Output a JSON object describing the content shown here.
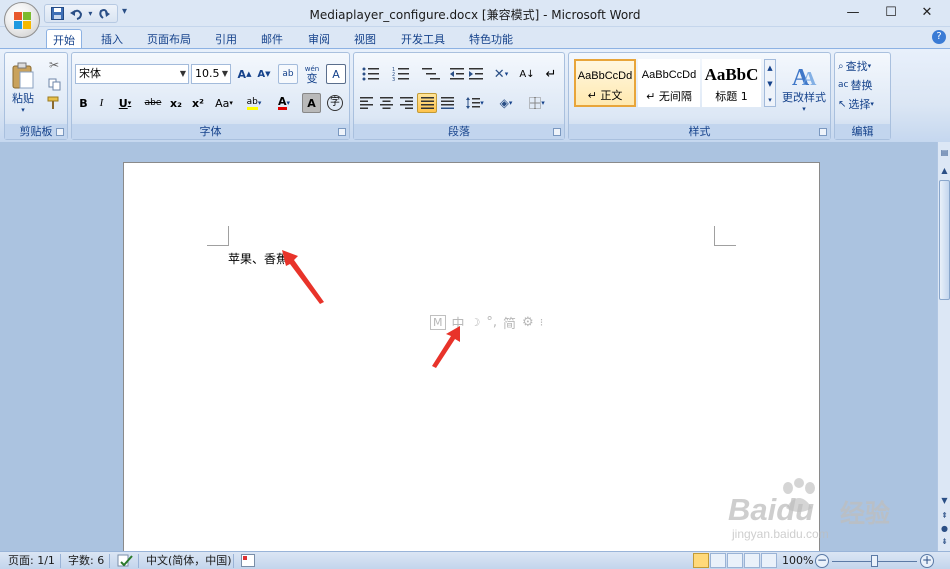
{
  "window": {
    "title": "Mediaplayer_configure.docx [兼容模式] - Microsoft Word",
    "minimize": "—",
    "maximize": "☐",
    "close": "✕"
  },
  "qat": {
    "save_icon": "save-icon",
    "undo_icon": "undo-icon",
    "redo_icon": "redo-icon",
    "more": "▾"
  },
  "tabs": [
    {
      "label": "开始",
      "active": true
    },
    {
      "label": "插入"
    },
    {
      "label": "页面布局"
    },
    {
      "label": "引用"
    },
    {
      "label": "邮件"
    },
    {
      "label": "审阅"
    },
    {
      "label": "视图"
    },
    {
      "label": "开发工具"
    },
    {
      "label": "特色功能"
    }
  ],
  "help": "?",
  "ribbon": {
    "clipboard": {
      "label": "剪贴板",
      "paste": "粘贴"
    },
    "font": {
      "label": "字体",
      "font_name": "宋体",
      "font_size": "10.5",
      "grow": "A",
      "shrink": "A",
      "clear": "ab",
      "phonetic": "wén",
      "border_char": "A",
      "bold": "B",
      "italic": "I",
      "underline": "U",
      "strike": "abe",
      "subscript": "x₂",
      "superscript": "x²",
      "case": "Aa",
      "highlight": "ab",
      "font_color": "A",
      "shade": "A",
      "enclose": "字"
    },
    "paragraph": {
      "label": "段落"
    },
    "styles": {
      "label": "样式",
      "items": [
        {
          "sample": "AaBbCcDd",
          "name": "↵ 正文",
          "selected": true
        },
        {
          "sample": "AaBbCcDd",
          "name": "↵ 无间隔"
        },
        {
          "sample": "AaBbC",
          "name": "标题 1"
        }
      ],
      "change": "更改样式"
    },
    "editing": {
      "label": "编辑",
      "find": "查找",
      "replace": "替换",
      "select": "选择"
    }
  },
  "document": {
    "text": "苹果、香蕉、",
    "ime": {
      "mode": "M",
      "lang": "中",
      "moon": "☽",
      "punct": "°,",
      "simp": "简",
      "gear": "⚙",
      "more": "⁝"
    }
  },
  "status": {
    "page": "页面: 1/1",
    "words": "字数: 6",
    "language": "中文(简体，中国)",
    "zoom": "100%",
    "zoom_level": 1.0
  },
  "watermark": {
    "brand": "Baidu",
    "jingyan": "经验",
    "url": "jingyan.baidu.com"
  },
  "colors": {
    "highlight": "#ffff00",
    "font_red": "#e00000",
    "arrow": "#e8332a"
  }
}
